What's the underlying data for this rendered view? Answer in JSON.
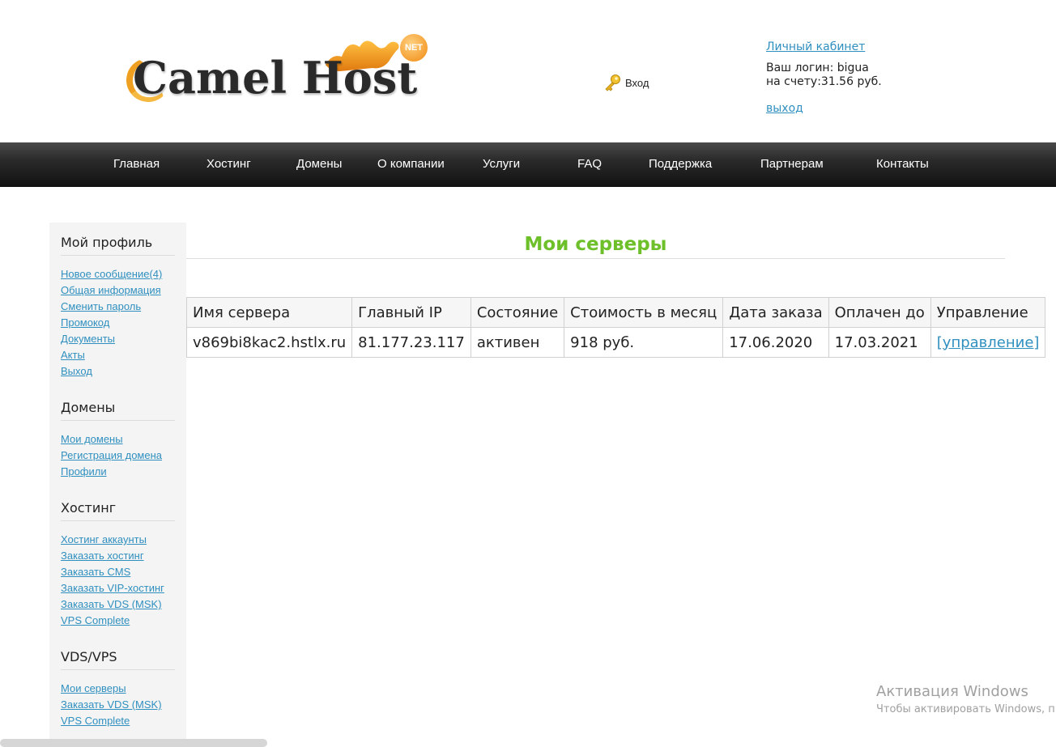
{
  "brand": {
    "logo_text": "Camel Host",
    "logo_badge": "NET"
  },
  "header": {
    "login_label": "Вход",
    "cabinet_link": "Личный кабинет",
    "login_line": "Ваш логин: bigua",
    "balance_line": "на счету:31.56 руб.",
    "logout_link": "выход"
  },
  "nav": {
    "items": [
      "Главная",
      "Хостинг",
      "Домены",
      "О компании",
      "Услуги",
      "FAQ",
      "Поддержка",
      "Партнерам",
      "Контакты"
    ]
  },
  "sidebar": {
    "sections": [
      {
        "title": "Мой профиль",
        "links": [
          "Новое сообщение(4)",
          "Общая информация",
          "Сменить пароль",
          "Промокод",
          "Документы",
          "Акты",
          "Выход"
        ]
      },
      {
        "title": "Домены",
        "links": [
          "Мои домены",
          "Регистрация домена",
          "Профили"
        ]
      },
      {
        "title": "Хостинг",
        "links": [
          "Хостинг аккаунты",
          "Заказать хостинг",
          "Заказать CMS",
          "Заказать VIP-хостинг",
          "Заказать VDS (MSK)",
          "VPS Complete"
        ]
      },
      {
        "title": "VDS/VPS",
        "links": [
          "Мои серверы",
          "Заказать VDS (MSK)",
          "VPS Complete"
        ]
      }
    ]
  },
  "main": {
    "title": "Мои серверы",
    "table": {
      "headers": [
        "Имя сервера",
        "Главный IP",
        "Состояние",
        "Стоимость в месяц",
        "Дата заказа",
        "Оплачен до",
        "Управление"
      ],
      "rows": [
        [
          "v869bi8kac2.hstlx.ru",
          "81.177.23.117",
          "активен",
          "918 руб.",
          "17.06.2020",
          "17.03.2021",
          "[управление]"
        ]
      ]
    }
  },
  "watermark": {
    "title": "Активация Windows",
    "subtitle": "Чтобы активировать Windows, п"
  },
  "colors": {
    "link": "#2f8fbf",
    "title_green": "#6dc02a",
    "nav_bg": "#1a1a1a",
    "sidebar_bg": "#f4f4f4"
  }
}
